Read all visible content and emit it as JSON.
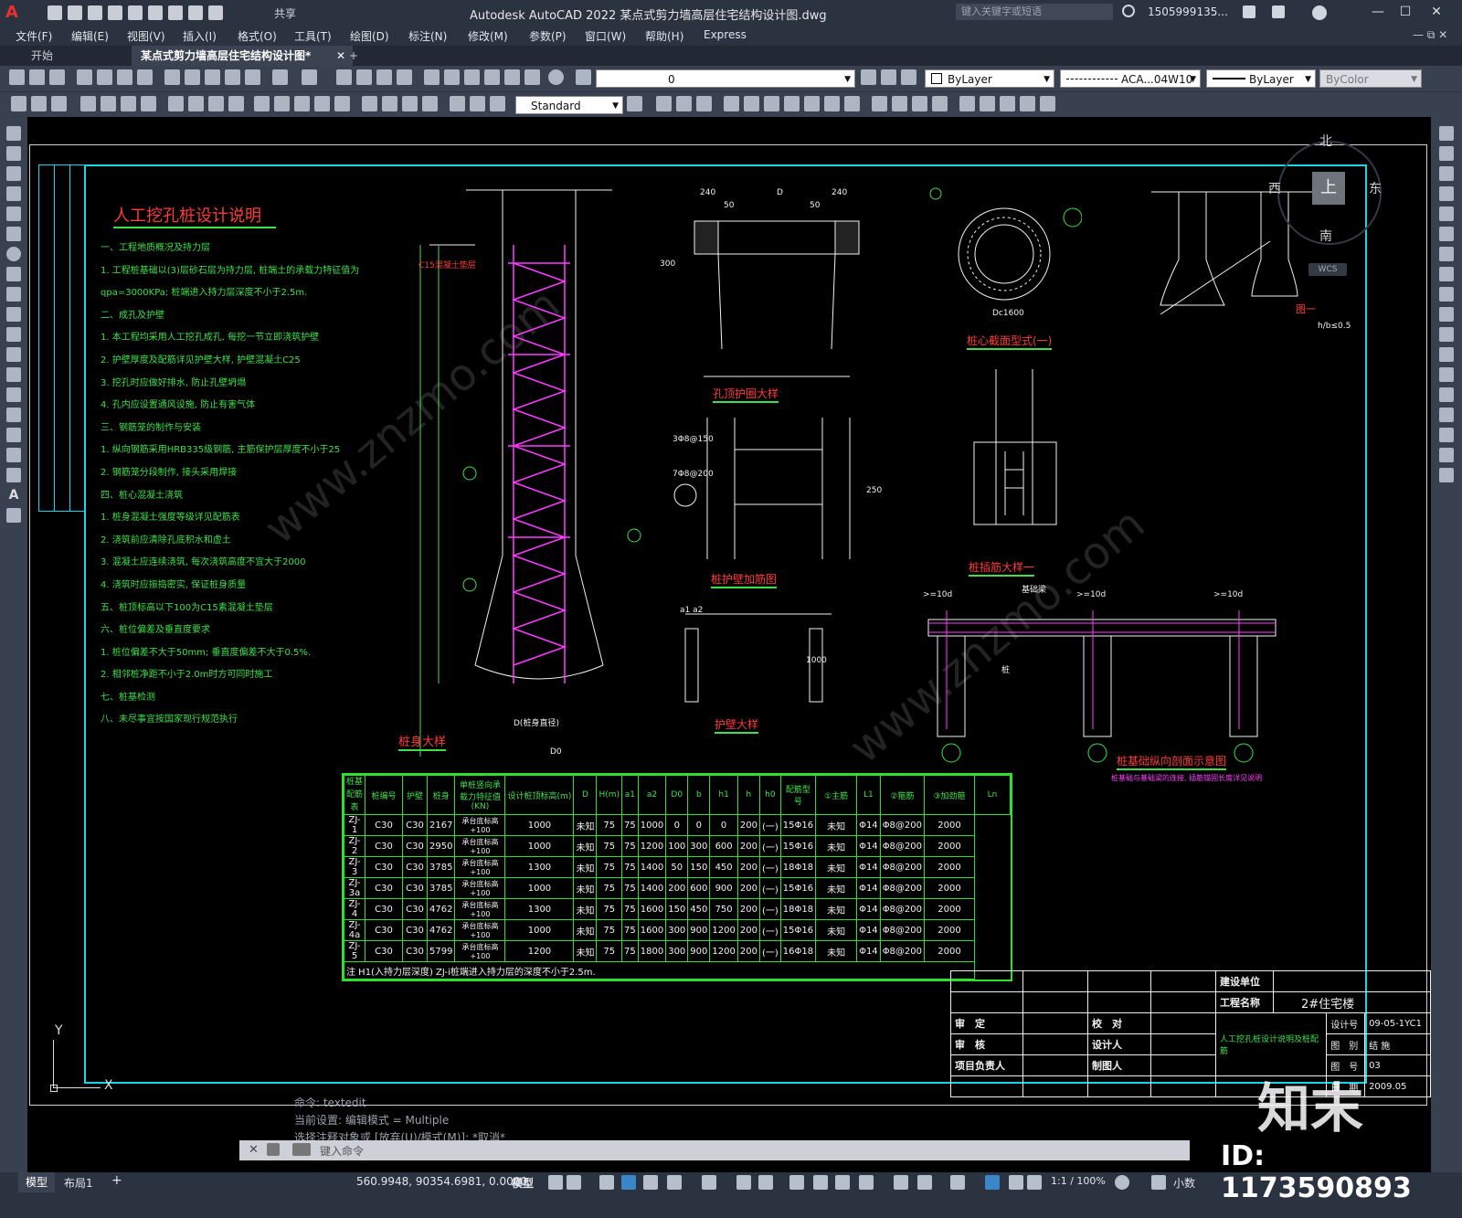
{
  "app": {
    "logo": "A",
    "share": "共享",
    "title": "Autodesk AutoCAD 2022    某点式剪力墙高层住宅结构设计图.dwg",
    "search_placeholder": "键入关键字或短语",
    "user": "1505999135...",
    "win_min": "—",
    "win_max": "☐",
    "win_close": "✕"
  },
  "menu": [
    "文件(F)",
    "编辑(E)",
    "视图(V)",
    "插入(I)",
    "格式(O)",
    "工具(T)",
    "绘图(D)",
    "标注(N)",
    "修改(M)",
    "参数(P)",
    "窗口(W)",
    "帮助(H)",
    "Express"
  ],
  "tabs": {
    "start": "开始",
    "file": "某点式剪力墙高层住宅结构设计图*",
    "close": "✕",
    "add": "+"
  },
  "toolbar": {
    "layer_value": "0",
    "color_value": "ByLayer",
    "linetype_value": "ACA...04W10",
    "lineweight_value": "ByLayer",
    "plotstyle_value": "ByColor",
    "textstyle_value": "Standard"
  },
  "viewcube": {
    "north": "北",
    "south": "南",
    "east": "东",
    "west": "西",
    "top": "上",
    "wcs": "WCS"
  },
  "drawing": {
    "notes_title": "人工挖孔桩设计说明",
    "notes": [
      "一、工程地质概况及持力层",
      "1. 工程桩基础以(3)层砂石层为持力层, 桩端土的承载力特征值为",
      "qpa=3000KPa; 桩端进入持力层深度不小于2.5m.",
      "二、成孔及护壁",
      "1. 本工程均采用人工挖孔成孔, 每挖一节立即浇筑护壁",
      "2. 护壁厚度及配筋详见护壁大样, 护壁混凝土C25",
      "3. 挖孔时应做好排水, 防止孔壁坍塌",
      "4. 孔内应设置通风设施, 防止有害气体",
      "三、钢筋笼的制作与安装",
      "1. 纵向钢筋采用HRB335级钢筋, 主筋保护层厚度不小于25",
      "2. 钢筋笼分段制作, 接头采用焊接",
      "四、桩心混凝土浇筑",
      "1. 桩身混凝土强度等级详见配筋表",
      "2. 浇筑前应清除孔底积水和虚土",
      "3. 混凝土应连续浇筑, 每次浇筑高度不宜大于2000",
      "4. 浇筑时应振捣密实, 保证桩身质量",
      "五、桩顶标高以下100为C15素混凝土垫层",
      "六、桩位偏差及垂直度要求",
      "1. 桩位偏差不大于50mm; 垂直度偏差不大于0.5%.",
      "2. 相邻桩净距不小于2.0m时方可同时施工",
      "七、桩基检测",
      "八、未尽事宜按国家现行规范执行"
    ],
    "labels": {
      "pile_detail": "桩身大样",
      "hole_protect": "孔顶护圈大样",
      "wall_rebar": "桩护壁加筋图",
      "protect_wall": "护壁大样",
      "section": "桩心截面型式(一)",
      "cap_detail": "桩插筋大样一",
      "beam_section": "桩基础纵向剖面示意图",
      "beam_note": "桩基础与基础梁的连接, 插筋锚固长度详见说明",
      "fig_one": "图一",
      "h_b": "h/b≤0.5",
      "beam_label": "基础梁",
      "pile_label": "桩",
      "dim_240a": "240",
      "dim_D": "D",
      "dim_240b": "240",
      "dim_50a": "50",
      "dim_50b": "50",
      "dim_300": "300",
      "c15": "C15混凝土垫层",
      "ten_d": ">=10d",
      "D_minus": "D(桩身直径)",
      "D0": "D0",
      "a1a2": "a1 a2",
      "reb1": "3Φ8@150",
      "reb2": "7Φ8@200",
      "dim_250": "250",
      "dim_1000": "1000",
      "dc": "Dc1600"
    },
    "table": {
      "side_label": "桩基配筋表",
      "headers": [
        "桩编号",
        "护壁",
        "桩身",
        "单桩竖向承载力特征值(KN)",
        "设计桩顶标高(m)",
        "D",
        "H(m)",
        "a1",
        "a2",
        "D0",
        "b",
        "h1",
        "h",
        "h0",
        "配筋型号",
        "①主筋",
        "L1",
        "②箍筋",
        "③加劲箍",
        "Ln"
      ],
      "rows": [
        [
          "ZJ-1",
          "C30",
          "C30",
          "2167",
          "承台底标高+100",
          "1000",
          "未知",
          "75",
          "75",
          "1000",
          "0",
          "0",
          "0",
          "200",
          "(一)",
          "15Φ16",
          "未知",
          "Φ14",
          "Φ8@200",
          "2000"
        ],
        [
          "ZJ-2",
          "C30",
          "C30",
          "2950",
          "承台底标高+100",
          "1000",
          "未知",
          "75",
          "75",
          "1200",
          "100",
          "300",
          "600",
          "200",
          "(一)",
          "15Φ16",
          "未知",
          "Φ14",
          "Φ8@200",
          "2000"
        ],
        [
          "ZJ-3",
          "C30",
          "C30",
          "3785",
          "承台底标高+100",
          "1300",
          "未知",
          "75",
          "75",
          "1400",
          "50",
          "150",
          "450",
          "200",
          "(一)",
          "18Φ18",
          "未知",
          "Φ14",
          "Φ8@200",
          "2000"
        ],
        [
          "ZJ-3a",
          "C30",
          "C30",
          "3785",
          "承台底标高+100",
          "1000",
          "未知",
          "75",
          "75",
          "1400",
          "200",
          "600",
          "900",
          "200",
          "(一)",
          "15Φ16",
          "未知",
          "Φ14",
          "Φ8@200",
          "2000"
        ],
        [
          "ZJ-4",
          "C30",
          "C30",
          "4762",
          "承台底标高+100",
          "1300",
          "未知",
          "75",
          "75",
          "1600",
          "150",
          "450",
          "750",
          "200",
          "(一)",
          "18Φ18",
          "未知",
          "Φ14",
          "Φ8@200",
          "2000"
        ],
        [
          "ZJ-4a",
          "C30",
          "C30",
          "4762",
          "承台底标高+100",
          "1000",
          "未知",
          "75",
          "75",
          "1600",
          "300",
          "900",
          "1200",
          "200",
          "(一)",
          "15Φ16",
          "未知",
          "Φ14",
          "Φ8@200",
          "2000"
        ],
        [
          "ZJ-5",
          "C30",
          "C30",
          "5799",
          "承台底标高+100",
          "1200",
          "未知",
          "75",
          "75",
          "1800",
          "300",
          "900",
          "1200",
          "200",
          "(一)",
          "16Φ18",
          "未知",
          "Φ14",
          "Φ8@200",
          "2000"
        ]
      ],
      "note": "注 H1(入持力层深度) ZJ-i桩端进入持力层的深度不小于2.5m."
    },
    "titleblock": {
      "build_unit": "建设单位",
      "project_name": "工程名称",
      "project_value": "2#住宅楼",
      "review": "审　定",
      "check": "审　核",
      "leader": "项目负责人",
      "proof": "校　对",
      "designer": "设计人",
      "drafter": "制图人",
      "drawing_title": "人工挖孔桩设计说明及桩配筋",
      "design_no_label": "设计号",
      "design_no": "09-05-1YC1",
      "category_label": "图　别",
      "category": "结 施",
      "sheet_label": "图　号",
      "sheet": "03",
      "date_label": "日　期",
      "date": "2009.05"
    }
  },
  "ucs": {
    "x": "X",
    "y": "Y"
  },
  "command": {
    "history": [
      "命令:  textedit",
      "当前设置: 编辑模式 = Multiple",
      "选择注释对象或 [放弃(U)/模式(M)]: *取消*"
    ],
    "placeholder": "键入命令"
  },
  "status": {
    "model_tab": "模型",
    "layout_tab": "布局1",
    "add_tab": "+",
    "coords": "560.9948, 90354.6981, 0.0000",
    "space": "模型",
    "scale": "1:1 / 100%",
    "units": "小数"
  },
  "watermark": {
    "brand": "知末",
    "id": "ID: 1173590893"
  },
  "colors": {
    "cyan": "#18d4e8",
    "green": "#3ee04a",
    "magenta": "#ff3cff",
    "red": "#ff3a3a",
    "yellow": "#f0e74a"
  }
}
